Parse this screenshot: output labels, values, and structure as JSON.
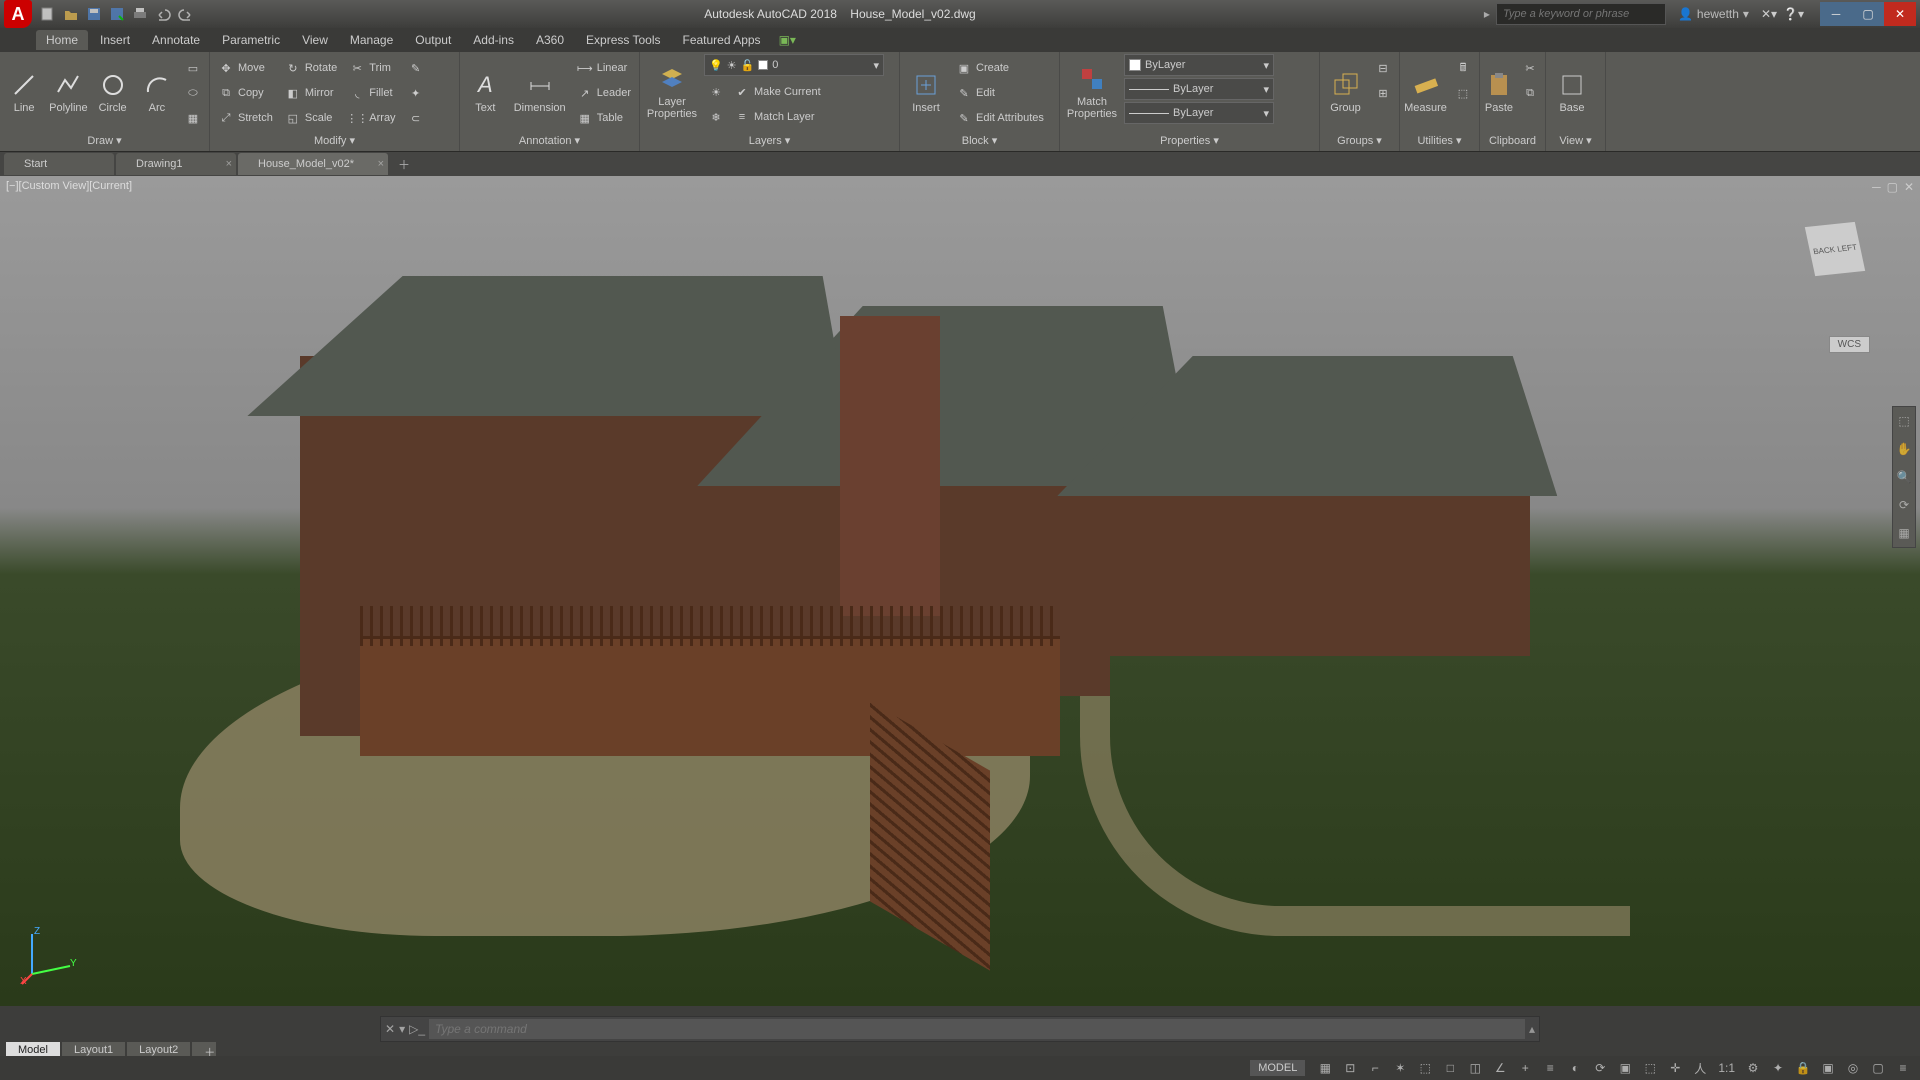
{
  "title": {
    "app": "Autodesk AutoCAD 2018",
    "file": "House_Model_v02.dwg"
  },
  "search": {
    "placeholder": "Type a keyword or phrase"
  },
  "user": {
    "name": "hewetth"
  },
  "menubar": [
    "Home",
    "Insert",
    "Annotate",
    "Parametric",
    "View",
    "Manage",
    "Output",
    "Add-ins",
    "A360",
    "Express Tools",
    "Featured Apps"
  ],
  "ribbon": {
    "draw": {
      "title": "Draw ▾",
      "line": "Line",
      "polyline": "Polyline",
      "circle": "Circle",
      "arc": "Arc"
    },
    "modify": {
      "title": "Modify ▾",
      "move": "Move",
      "rotate": "Rotate",
      "trim": "Trim",
      "copy": "Copy",
      "mirror": "Mirror",
      "fillet": "Fillet",
      "stretch": "Stretch",
      "scale": "Scale",
      "array": "Array"
    },
    "annotation": {
      "title": "Annotation ▾",
      "text": "Text",
      "dimension": "Dimension",
      "linear": "Linear",
      "leader": "Leader",
      "table": "Table"
    },
    "layers": {
      "title": "Layers ▾",
      "props": "Layer\nProperties",
      "current": "0",
      "make": "Make Current",
      "match": "Match Layer"
    },
    "block": {
      "title": "Block ▾",
      "insert": "Insert",
      "create": "Create",
      "edit": "Edit",
      "attrib": "Edit Attributes"
    },
    "properties": {
      "title": "Properties ▾",
      "match": "Match\nProperties",
      "color": "ByLayer",
      "ltype": "ByLayer",
      "lweight": "ByLayer"
    },
    "groups": {
      "title": "Groups ▾",
      "group": "Group"
    },
    "utilities": {
      "title": "Utilities ▾",
      "measure": "Measure"
    },
    "clipboard": {
      "title": "Clipboard",
      "paste": "Paste"
    },
    "view": {
      "title": "View ▾",
      "base": "Base"
    }
  },
  "tabs": {
    "start": "Start",
    "drawing1": "Drawing1",
    "house": "House_Model_v02*"
  },
  "viewport": {
    "label": "[−][Custom View][Current]",
    "wcs": "WCS",
    "cube_back": "BACK",
    "cube_left": "LEFT"
  },
  "command": {
    "placeholder": "Type a command"
  },
  "layouts": {
    "model": "Model",
    "l1": "Layout1",
    "l2": "Layout2"
  },
  "status": {
    "model": "MODEL",
    "scale": "1:1"
  },
  "ucs": {
    "x": "X",
    "y": "Y",
    "z": "Z"
  }
}
